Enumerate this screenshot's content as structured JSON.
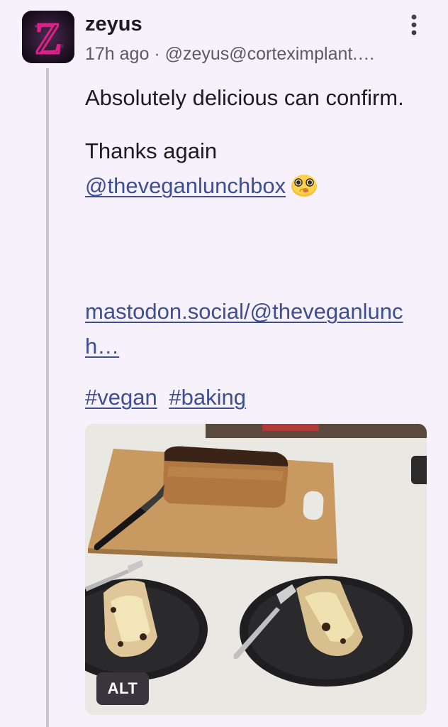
{
  "post": {
    "display_name": "zeyus",
    "meta": "17h ago · @zeyus@corteximplant.…",
    "body_line1": "Absolutely delicious can confirm.",
    "body_line2": "Thanks again",
    "mention": "@theveganlunchbox",
    "url": "mastodon.social/@theveganlunch…",
    "tags": [
      "#vegan",
      "#baking"
    ],
    "avatar_letter": "Z"
  },
  "media": {
    "alt_label": "ALT"
  },
  "icons": {
    "more": "more-vertical-icon",
    "emoji": "pleading-face-emoji"
  }
}
